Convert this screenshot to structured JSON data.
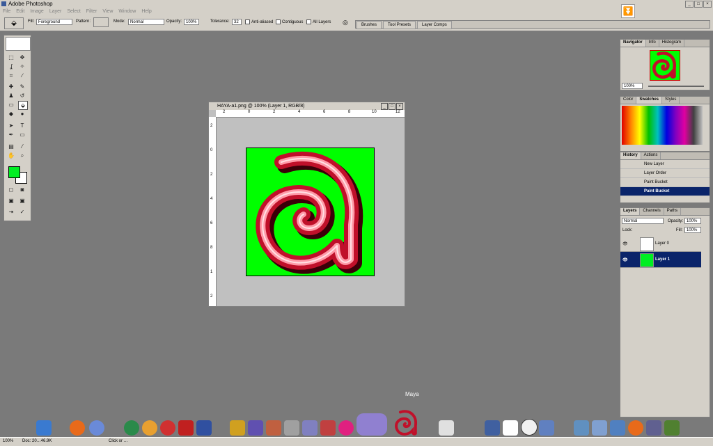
{
  "app": {
    "title": "Adobe Photoshop",
    "window_buttons": [
      "_",
      "□",
      "×"
    ]
  },
  "menu": [
    "File",
    "Edit",
    "Image",
    "Layer",
    "Select",
    "Filter",
    "View",
    "Window",
    "Help"
  ],
  "options": {
    "fill_label": "Fill:",
    "fill_value": "Foreground",
    "pattern_label": "Pattern:",
    "mode_label": "Mode:",
    "mode_value": "Normal",
    "opacity_label": "Opacity:",
    "opacity_value": "100%",
    "tolerance_label": "Tolerance:",
    "tolerance_value": "32",
    "anti_aliased": "Anti-aliased",
    "contiguous": "Contiguous",
    "all_layers": "All Layers"
  },
  "palette_well": [
    "Brushes",
    "Tool Presets",
    "Layer Comps"
  ],
  "document": {
    "title": "HAYA-a1.png @ 100% (Layer 1, RGB/8)",
    "ruler_h": [
      "2",
      "0",
      "2",
      "4",
      "6",
      "8",
      "10",
      "12"
    ],
    "ruler_v": [
      "2",
      "0",
      "2",
      "4",
      "6",
      "8",
      "1",
      "2"
    ]
  },
  "navigator": {
    "tabs": [
      "Navigator",
      "Info",
      "Histogram"
    ],
    "zoom": "100%"
  },
  "swatches": {
    "tabs": [
      "Color",
      "Swatches",
      "Styles"
    ]
  },
  "history": {
    "tabs": [
      "History",
      "Actions"
    ],
    "items": [
      "New Layer",
      "Layer Order",
      "Paint Bucket",
      "Paint Bucket"
    ]
  },
  "layers": {
    "tabs": [
      "Layers",
      "Channels",
      "Paths"
    ],
    "blend": "Normal",
    "opacity_label": "Opacity:",
    "opacity": "100%",
    "lock_label": "Lock:",
    "fill_label": "Fill:",
    "fill": "100%",
    "items": [
      "Layer 0",
      "Layer 1"
    ]
  },
  "status": {
    "zoom": "100%",
    "doc": "Doc: 20…46.9K",
    "hint": "Click or …"
  },
  "dock": {
    "label": "Maya"
  },
  "colors": {
    "foreground": "#00ee22",
    "canvas": "#00ff00",
    "accent": "#0a246a"
  }
}
